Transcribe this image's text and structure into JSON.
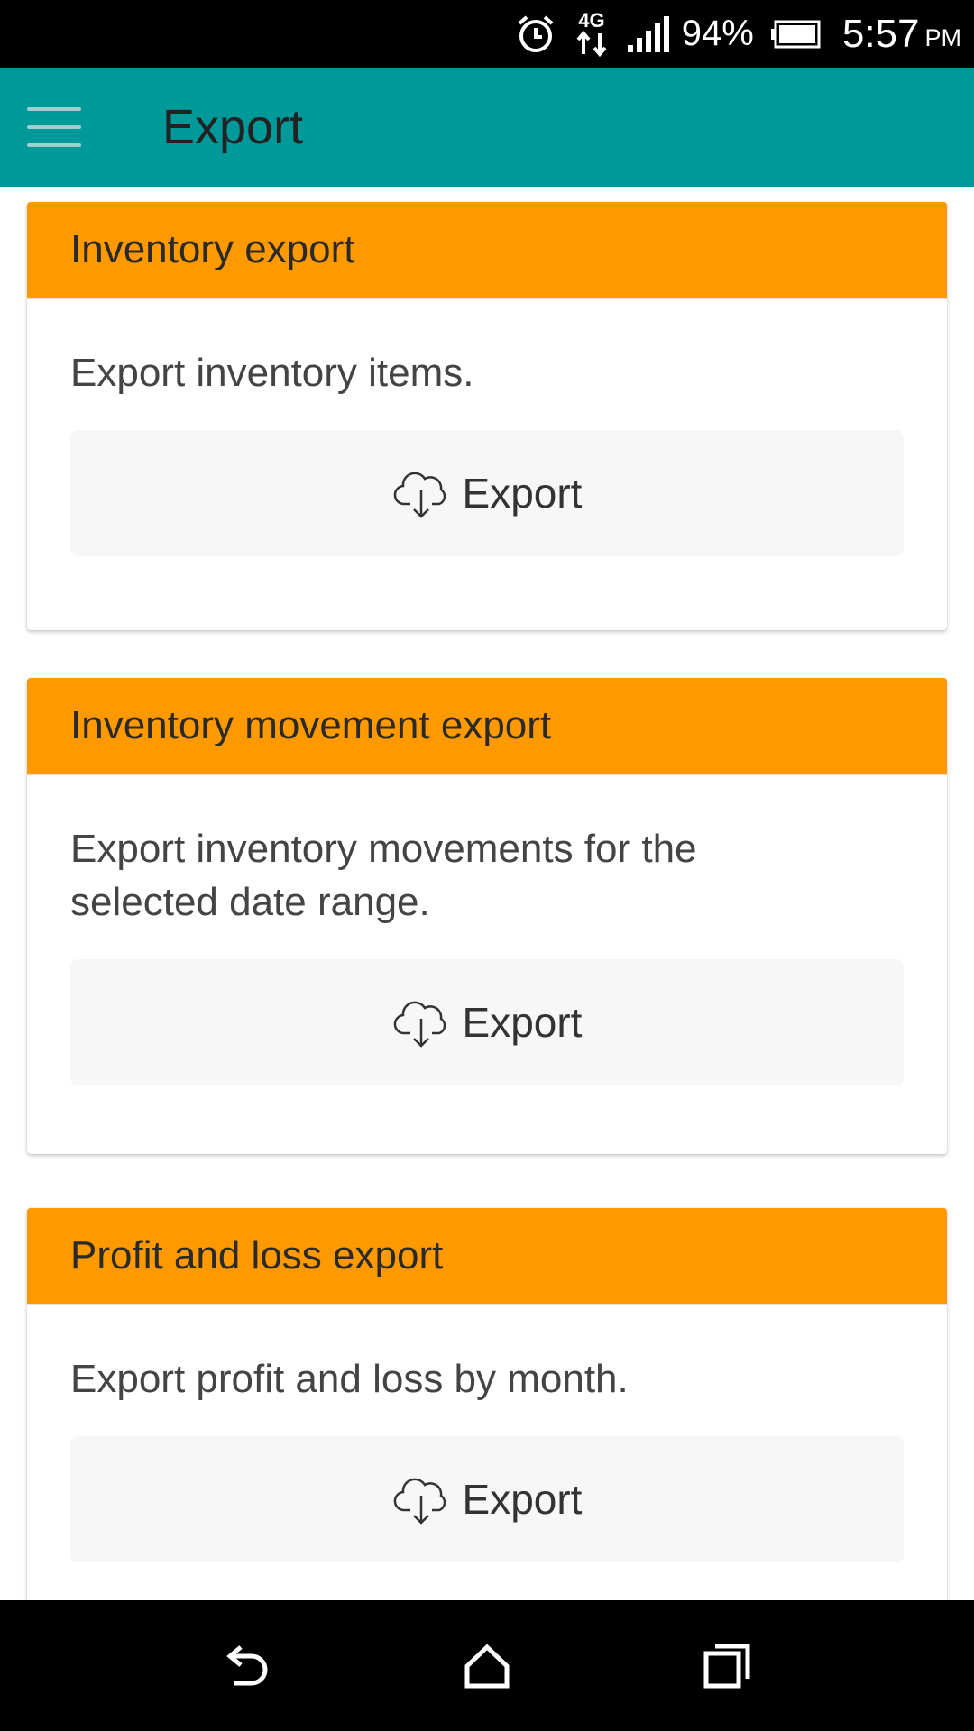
{
  "status_bar": {
    "alarm_icon": "alarm-clock-icon",
    "network_label": "4G",
    "signal_icon": "signal-bars-icon",
    "battery_percent": "94%",
    "battery_icon": "battery-icon",
    "time": "5:57",
    "ampm": "PM"
  },
  "app_bar": {
    "menu_icon": "hamburger-menu-icon",
    "title": "Export",
    "background_color": "#009999"
  },
  "cards": [
    {
      "title": "Inventory export",
      "description": "Export inventory items.",
      "button_label": "Export",
      "button_icon": "cloud-download-icon"
    },
    {
      "title": "Inventory movement export",
      "description": "Export inventory movements for the selected date range.",
      "button_label": "Export",
      "button_icon": "cloud-download-icon"
    },
    {
      "title": "Profit and loss export",
      "description": "Export profit and loss by month.",
      "button_label": "Export",
      "button_icon": "cloud-download-icon"
    }
  ],
  "card_header_color": "#ff9900",
  "nav_bar": {
    "back_icon": "back-arrow-icon",
    "home_icon": "home-icon",
    "recents_icon": "recent-apps-icon"
  }
}
